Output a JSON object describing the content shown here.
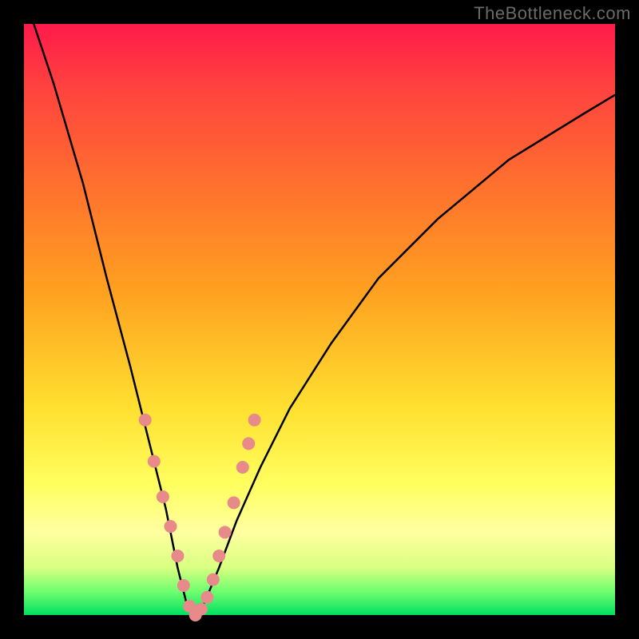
{
  "watermark": "TheBottleneck.com",
  "chart_data": {
    "type": "line",
    "title": "",
    "xlabel": "",
    "ylabel": "",
    "ylim": [
      0,
      100
    ],
    "xlim": [
      0,
      100
    ],
    "background_gradient": {
      "top": "#ff1a4a",
      "middle": "#ffe030",
      "bottom": "#00e060"
    },
    "series": [
      {
        "name": "bottleneck-curve",
        "x": [
          0,
          5,
          10,
          14,
          18,
          21,
          24,
          26,
          27.5,
          29,
          30.5,
          33,
          36,
          40,
          45,
          52,
          60,
          70,
          82,
          95,
          100
        ],
        "values": [
          105,
          90,
          73,
          57,
          42,
          30,
          18,
          8,
          2,
          0,
          2,
          8,
          16,
          25,
          35,
          46,
          57,
          67,
          77,
          85,
          88
        ]
      }
    ],
    "markers": {
      "name": "highlight-points",
      "color": "#e88a8a",
      "x": [
        20.5,
        22.0,
        23.5,
        24.8,
        26.0,
        27.0,
        28.0,
        29.0,
        30.0,
        31.0,
        32.0,
        33.0,
        34.0,
        35.5,
        37.0,
        38.0,
        39.0
      ],
      "values": [
        33.0,
        26.0,
        20.0,
        15.0,
        10.0,
        5.0,
        1.5,
        0.0,
        1.0,
        3.0,
        6.0,
        10.0,
        14.0,
        19.0,
        25.0,
        29.0,
        33.0
      ]
    }
  }
}
